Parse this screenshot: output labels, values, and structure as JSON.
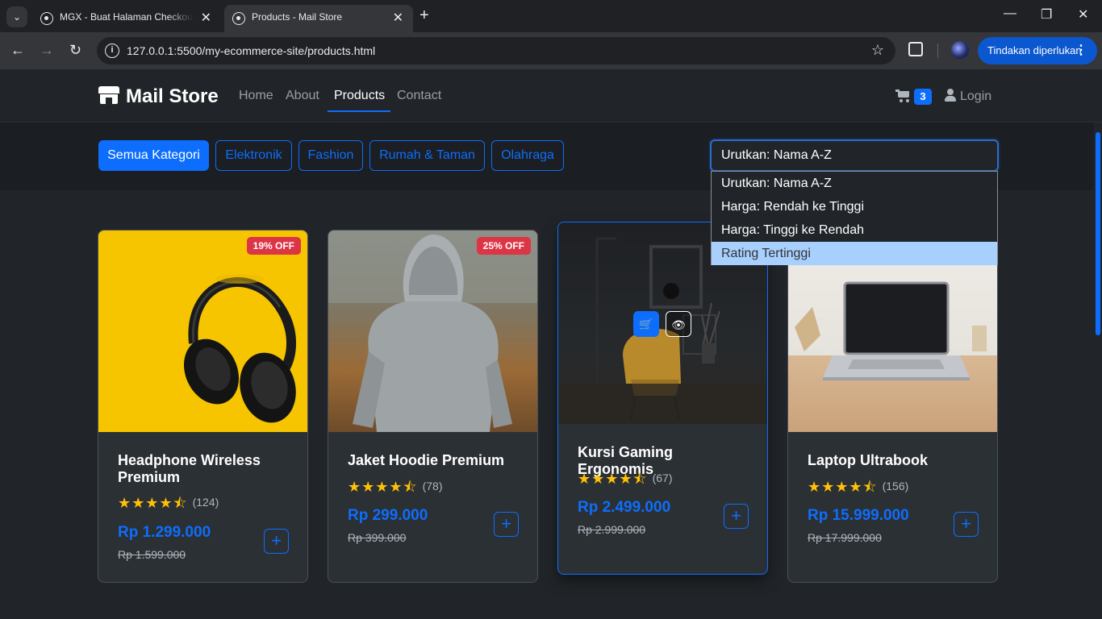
{
  "browser": {
    "tabs": [
      {
        "title": "MGX - Buat Halaman Checkout"
      },
      {
        "title": "Products - Mail Store"
      }
    ],
    "url": "127.0.0.1:5500/my-ecommerce-site/products.html",
    "action_label": "Tindakan diperlukan"
  },
  "nav": {
    "brand": "Mail Store",
    "links": [
      "Home",
      "About",
      "Products",
      "Contact"
    ],
    "active": "Products",
    "cart_count": "3",
    "login": "Login"
  },
  "filters": {
    "categories": [
      "Semua Kategori",
      "Elektronik",
      "Fashion",
      "Rumah & Taman",
      "Olahraga"
    ],
    "active_category": "Semua Kategori",
    "sort_selected": "Urutkan: Nama A-Z",
    "sort_options": [
      "Urutkan: Nama A-Z",
      "Harga: Rendah ke Tinggi",
      "Harga: Tinggi ke Rendah",
      "Rating Tertinggi"
    ],
    "sort_highlighted": "Rating Tertinggi"
  },
  "products": [
    {
      "name": "Headphone Wireless Premium",
      "discount": "19% OFF",
      "rating": 4.5,
      "stars": "★★★★⯪",
      "reviews": "(124)",
      "price": "Rp 1.299.000",
      "old_price": "Rp 1.599.000",
      "add": "+"
    },
    {
      "name": "Jaket Hoodie Premium",
      "discount": "25% OFF",
      "rating": 4.5,
      "stars": "★★★★⯪",
      "reviews": "(78)",
      "price": "Rp 299.000",
      "old_price": "Rp 399.000",
      "add": "+"
    },
    {
      "name": "Kursi Gaming Ergonomis",
      "discount": "",
      "rating": 4.5,
      "stars": "★★★★⯪",
      "reviews": "(67)",
      "price": "Rp 2.499.000",
      "old_price": "Rp 2.999.000",
      "add": "+"
    },
    {
      "name": "Laptop Ultrabook",
      "discount": "",
      "rating": 4.5,
      "stars": "★★★★⯪",
      "reviews": "(156)",
      "price": "Rp 15.999.000",
      "old_price": "Rp 17.999.000",
      "add": "+"
    }
  ],
  "colors": {
    "primary": "#0d6efd",
    "danger": "#dc3545",
    "star": "#ffc107",
    "background": "#212529"
  }
}
